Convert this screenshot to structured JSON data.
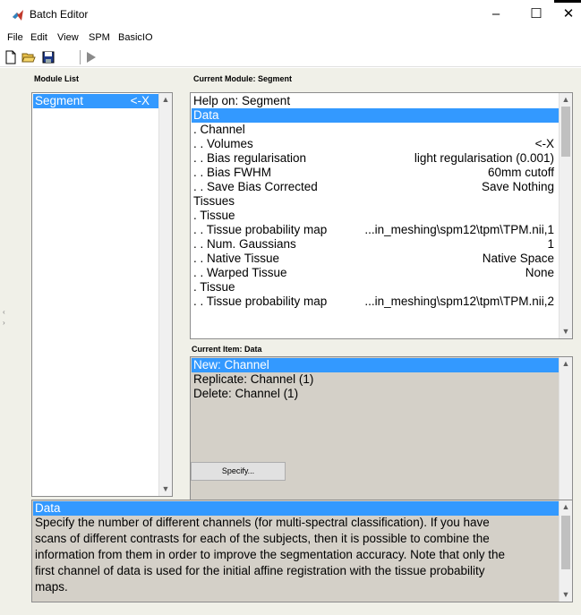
{
  "window": {
    "title": "Batch Editor",
    "controls": {
      "minimize": "–",
      "maximize": "☐",
      "close": "✕"
    }
  },
  "menu": [
    "File",
    "Edit",
    "View",
    "SPM",
    "BasicIO"
  ],
  "toolbar": {
    "buttons": [
      {
        "name": "new",
        "icon": "new-document-icon"
      },
      {
        "name": "open",
        "icon": "open-folder-icon"
      },
      {
        "name": "save",
        "icon": "save-disk-icon"
      },
      {
        "name": "run",
        "icon": "run-play-icon"
      }
    ]
  },
  "module_list": {
    "label": "Module List",
    "items": [
      {
        "label": "Segment",
        "status": "<-X"
      }
    ]
  },
  "current_module": {
    "label": "Current Module: Segment",
    "rows": [
      {
        "label": "Help on: Segment",
        "value": ""
      },
      {
        "label": "Data",
        "value": ""
      },
      {
        "label": ". Channel",
        "value": ""
      },
      {
        "label": ". . Volumes",
        "value": "<-X"
      },
      {
        "label": ". . Bias regularisation",
        "value": "light regularisation (0.001)"
      },
      {
        "label": ". . Bias FWHM",
        "value": "60mm cutoff"
      },
      {
        "label": ". . Save Bias Corrected",
        "value": "Save Nothing"
      },
      {
        "label": "Tissues",
        "value": ""
      },
      {
        "label": ". Tissue",
        "value": ""
      },
      {
        "label": ". . Tissue probability map",
        "value": "...in_meshing\\spm12\\tpm\\TPM.nii,1"
      },
      {
        "label": ". . Num. Gaussians",
        "value": "1"
      },
      {
        "label": ". . Native Tissue",
        "value": "Native Space"
      },
      {
        "label": ". . Warped Tissue",
        "value": "None"
      },
      {
        "label": ". Tissue",
        "value": ""
      },
      {
        "label": ". . Tissue probability map",
        "value": "...in_meshing\\spm12\\tpm\\TPM.nii,2"
      }
    ]
  },
  "current_item": {
    "label": "Current Item: Data",
    "rows": [
      "New: Channel",
      "Replicate: Channel (1)",
      "Delete: Channel (1)"
    ]
  },
  "specify_button": "Specify...",
  "help": {
    "title": "Data",
    "lines": [
      "Specify the number of different channels (for multi-spectral classification). If you have",
      "scans of different contrasts for each of the subjects, then it is possible to combine the",
      "information from them in order to improve the segmentation accuracy. Note that only the",
      "first channel of data is used for the initial affine registration with the tissue probability",
      "maps."
    ]
  },
  "colors": {
    "selection": "#3399ff",
    "panel": "#f0f0e8",
    "text_panel": "#d4d0c8"
  }
}
